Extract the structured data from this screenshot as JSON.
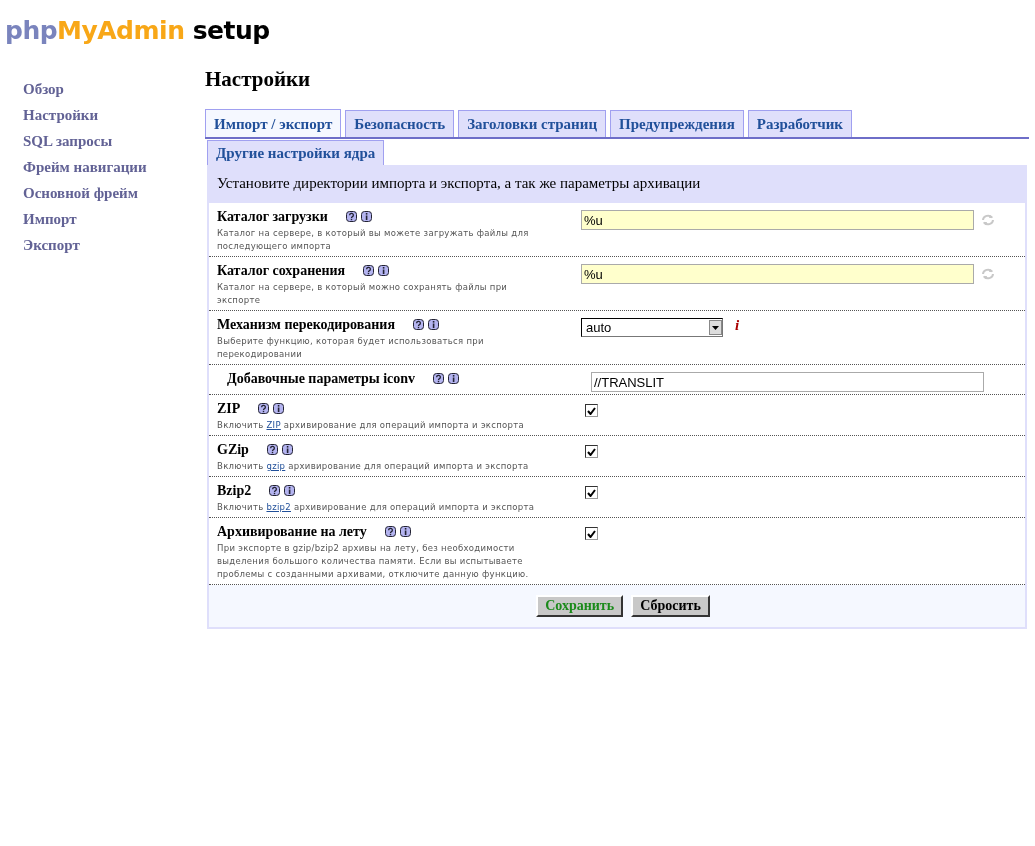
{
  "logo": {
    "part_1": "php",
    "part_2": "MyAdmin",
    "part_3": "setup"
  },
  "sidebar": {
    "items": [
      "Обзор",
      "Настройки",
      "SQL запросы",
      "Фрейм навигации",
      "Основной фрейм",
      "Импорт",
      "Экспорт"
    ]
  },
  "page_title": "Настройки",
  "tabs": [
    {
      "label": "Импорт / экспорт",
      "selected": true
    },
    {
      "label": "Безопасность",
      "selected": false
    },
    {
      "label": "Заголовки страниц",
      "selected": false
    },
    {
      "label": "Предупреждения",
      "selected": false
    },
    {
      "label": "Разработчик",
      "selected": false
    }
  ],
  "subtabs": [
    "Другие настройки ядра"
  ],
  "panel": {
    "heading": "Установите директории импорта и экспорта, а так же параметры архивации",
    "rows": [
      {
        "kind": "text",
        "label": "Каталог загрузки",
        "indented": false,
        "description": "Каталог на сервере, в который вы можете загружать файлы для последующего импорта",
        "value": "%u",
        "custom": true
      },
      {
        "kind": "text",
        "label": "Каталог сохранения",
        "indented": false,
        "description": "Каталог на сервере, в который можно сохранять файлы при экспорте",
        "value": "%u",
        "custom": true
      },
      {
        "kind": "select",
        "label": "Механизм перекодирования",
        "indented": false,
        "description": "Выберите функцию, которая будет использоваться при перекодировании",
        "value": "auto",
        "note": "i"
      },
      {
        "kind": "text",
        "label": "Добавочные параметры iconv",
        "indented": true,
        "value": "//TRANSLIT",
        "custom": false
      },
      {
        "kind": "checkbox",
        "label": "ZIP",
        "indented": false,
        "desc_before": "Включить ",
        "link": "ZIP",
        "desc_after": " архивирование для операций импорта и экспорта",
        "checked": true
      },
      {
        "kind": "checkbox",
        "label": "GZip",
        "indented": false,
        "desc_before": "Включить ",
        "link": "gzip",
        "desc_after": " архивирование для операций импорта и экспорта",
        "checked": true
      },
      {
        "kind": "checkbox",
        "label": "Bzip2",
        "indented": false,
        "desc_before": "Включить ",
        "link": "bzip2",
        "desc_after": " архивирование для операций импорта и экспорта",
        "checked": true
      },
      {
        "kind": "checkbox",
        "label": "Архивирование на лету",
        "indented": false,
        "description": "При экспорте в gzip/bzip2 архивы на лету, без необходимости выделения большого количества памяти. Если вы испытываете проблемы с созданными архивами, отключите данную функцию.",
        "checked": true
      }
    ],
    "buttons": [
      {
        "label": "Сохранить",
        "kind": "primary"
      },
      {
        "label": "Сбросить",
        "kind": "secondary"
      }
    ]
  }
}
